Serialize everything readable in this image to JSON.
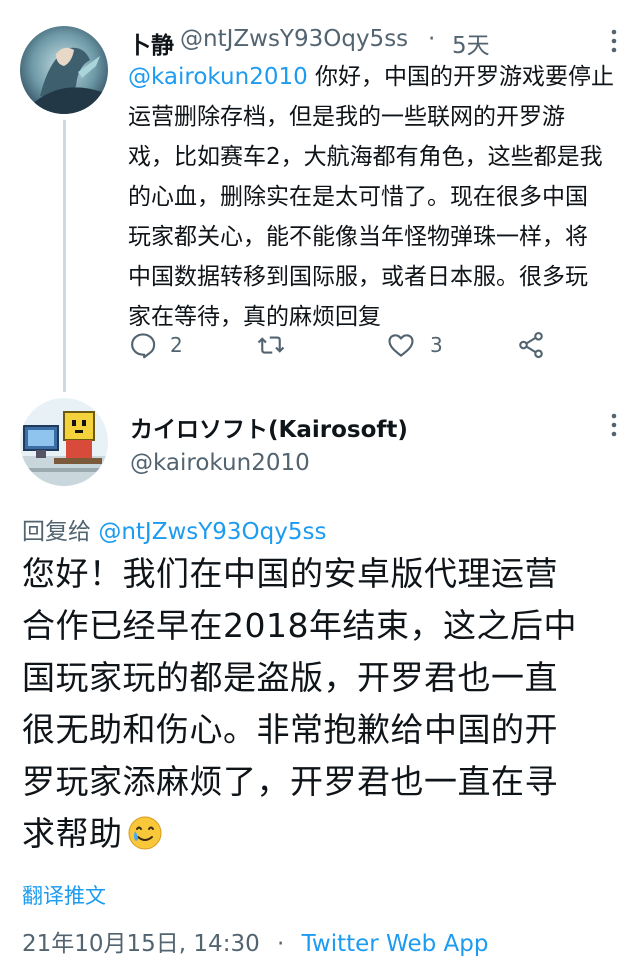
{
  "reply_tweet": {
    "author_name": "卜静",
    "author_handle": "@ntJZwsY93Oqy5ss",
    "separator": "·",
    "time_ago": "5天",
    "mention": "@kairokun2010",
    "body_lines": [
      " 你好，中国的开罗游戏要停止",
      "运营删除存档，但是我的一些联网的开罗游",
      "戏，比如赛车2，大航海都有角色，这些都是我",
      "的心血，删除实在是太可惜了。现在很多中国",
      "玩家都关心，能不能像当年怪物弹珠一样，将",
      "中国数据转移到国际服，或者日本服。很多玩",
      "家在等待，真的麻烦回复"
    ],
    "reply_count": "2",
    "like_count": "3"
  },
  "main_tweet": {
    "author_name": "カイロソフト(Kairosoft)",
    "author_handle": "@kairokun2010",
    "replying_to_label": "回复给",
    "replying_to_handle": "@ntJZwsY93Oqy5ss",
    "body_lines": [
      "您好！我们在中国的安卓版代理运营",
      "合作已经早在2018年结束，这之后中",
      "国玩家玩的都是盗版，开罗君也一直",
      "很无助和伤心。非常抱歉给中国的开",
      "罗玩家添麻烦了，开罗君也一直在寻",
      "求帮助"
    ],
    "emoji": "🥲",
    "translate_label": "翻译推文",
    "timestamp": "21年10月15日, 14:30",
    "separator": "·",
    "source": "Twitter Web App"
  },
  "colors": {
    "link": "#1d9bf0",
    "secondary_text": "#536471",
    "thread_line": "#cfd9de"
  }
}
